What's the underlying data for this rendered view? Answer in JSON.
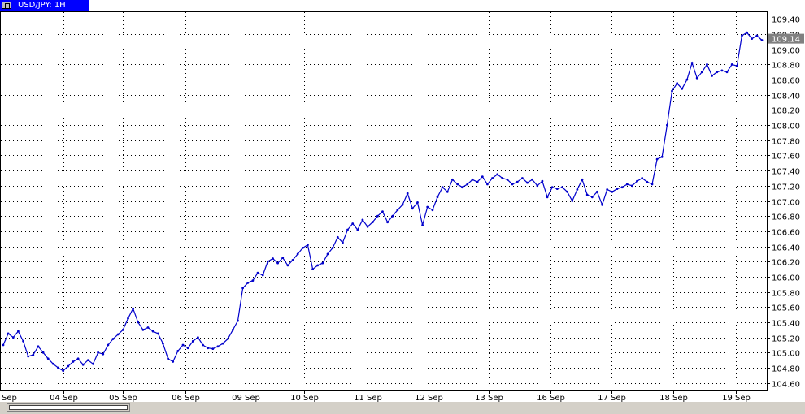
{
  "window": {
    "tab_label": "USD/JPY: 1H"
  },
  "colors": {
    "line": "#0000cc",
    "grid": "#000000",
    "frame": "#000000",
    "price_tag_bg": "#808080",
    "tab_bg": "#0000ff"
  },
  "chart_data": {
    "type": "line",
    "title": "",
    "xlabel": "",
    "ylabel": "",
    "ylim": [
      104.5,
      109.5
    ],
    "y_ticks": [
      "104.60",
      "104.80",
      "105.00",
      "105.20",
      "105.40",
      "105.60",
      "105.80",
      "106.00",
      "106.20",
      "106.40",
      "106.60",
      "106.80",
      "107.00",
      "107.20",
      "107.40",
      "107.60",
      "107.80",
      "108.00",
      "108.20",
      "108.40",
      "108.60",
      "108.80",
      "109.00",
      "109.20",
      "109.40"
    ],
    "x_ticks": [
      "Sep",
      "04 Sep",
      "05 Sep",
      "06 Sep",
      "09 Sep",
      "10 Sep",
      "11 Sep",
      "12 Sep",
      "13 Sep",
      "16 Sep",
      "17 Sep",
      "18 Sep",
      "19 Sep"
    ],
    "current_price_label": "109.14",
    "grid": true,
    "series": [
      {
        "x_range": [
          0,
          12.5
        ],
        "values": [
          105.1,
          105.25,
          105.2,
          105.28,
          105.15,
          104.95,
          104.97,
          105.08,
          105.0,
          104.92,
          104.85,
          104.8,
          104.76,
          104.82,
          104.88,
          104.92,
          104.84,
          104.9,
          104.85,
          105.0,
          104.98,
          105.1,
          105.18,
          105.24,
          105.3,
          105.45,
          105.58,
          105.4,
          105.3,
          105.33,
          105.28,
          105.25,
          105.12,
          104.92,
          104.88,
          105.02,
          105.1,
          105.06,
          105.15,
          105.2,
          105.1,
          105.06,
          105.05,
          105.08,
          105.12,
          105.18,
          105.3,
          105.42,
          105.85,
          105.92,
          105.95,
          106.05,
          106.02,
          106.2,
          106.24,
          106.18,
          106.25,
          106.15,
          106.22,
          106.3,
          106.38,
          106.42,
          106.1,
          106.15,
          106.18,
          106.3,
          106.38,
          106.52,
          106.45,
          106.62,
          106.7,
          106.62,
          106.75,
          106.66,
          106.72,
          106.8,
          106.86,
          106.72,
          106.8,
          106.88,
          106.95,
          107.1,
          106.9,
          106.98,
          106.68,
          106.92,
          106.88,
          107.05,
          107.18,
          107.12,
          107.28,
          107.22,
          107.18,
          107.22,
          107.28,
          107.25,
          107.32,
          107.22,
          107.3,
          107.35,
          107.3,
          107.28,
          107.22,
          107.25,
          107.3,
          107.24,
          107.28,
          107.2,
          107.26,
          107.05,
          107.18,
          107.16,
          107.18,
          107.12,
          107.0,
          107.15,
          107.28,
          107.08,
          107.05,
          107.12,
          106.95,
          107.15,
          107.12,
          107.16,
          107.18,
          107.22,
          107.2,
          107.26,
          107.3,
          107.25,
          107.22,
          107.55,
          107.58,
          108.0,
          108.45,
          108.55,
          108.48,
          108.6,
          108.82,
          108.62,
          108.7,
          108.8,
          108.65,
          108.7,
          108.72,
          108.7,
          108.8,
          108.78,
          109.18,
          109.22,
          109.14,
          109.18,
          109.12
        ]
      }
    ]
  }
}
